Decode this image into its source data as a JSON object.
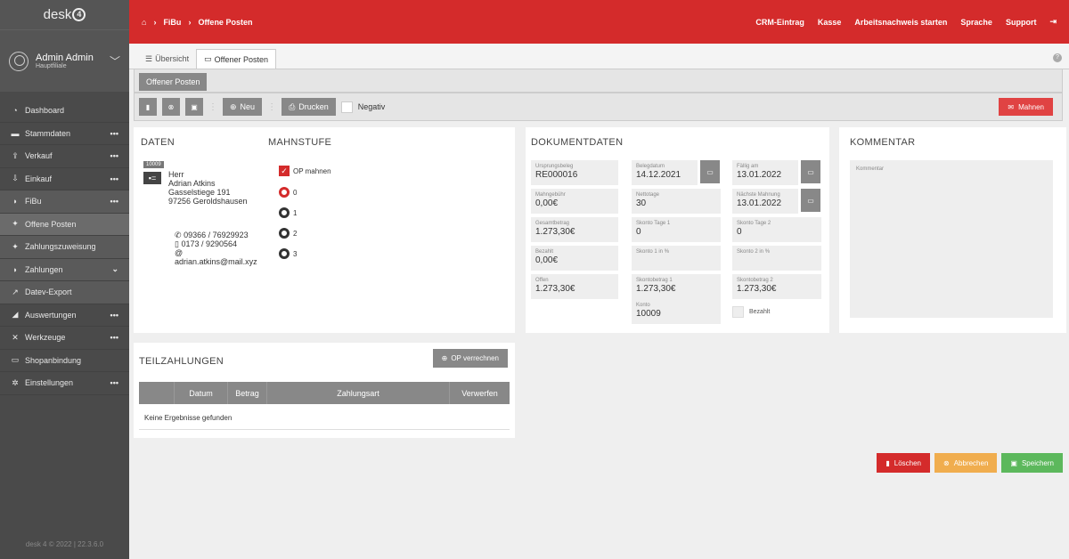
{
  "app": {
    "logo": "desk",
    "logo_mark": "4"
  },
  "user": {
    "name": "Admin Admin",
    "branch": "Hauptfiliale"
  },
  "sidebar": {
    "items": [
      {
        "label": "Dashboard",
        "icon": "dashboard-icon",
        "more": ""
      },
      {
        "label": "Stammdaten",
        "icon": "database-icon",
        "more": "•••"
      },
      {
        "label": "Verkauf",
        "icon": "upload-icon",
        "more": "•••"
      },
      {
        "label": "Einkauf",
        "icon": "download-icon",
        "more": "•••"
      },
      {
        "label": "FiBu",
        "icon": "fibu-icon",
        "more": "•••"
      },
      {
        "label": "Offene Posten",
        "icon": "money-icon",
        "more": ""
      },
      {
        "label": "Zahlungszuweisung",
        "icon": "money-icon",
        "more": ""
      },
      {
        "label": "Zahlungen",
        "icon": "payments-icon",
        "more": "⌄"
      },
      {
        "label": "Datev-Export",
        "icon": "export-icon",
        "more": ""
      },
      {
        "label": "Auswertungen",
        "icon": "chart-icon",
        "more": "•••"
      },
      {
        "label": "Werkzeuge",
        "icon": "tools-icon",
        "more": "•••"
      },
      {
        "label": "Shopanbindung",
        "icon": "shop-icon",
        "more": ""
      },
      {
        "label": "Einstellungen",
        "icon": "gear-icon",
        "more": "•••"
      }
    ],
    "footer": "desk 4 © 2022 | 22.3.6.0"
  },
  "topbar": {
    "crumb1": "FiBu",
    "crumb2": "Offene Posten",
    "crm": "CRM-Eintrag",
    "kasse": "Kasse",
    "arbeit": "Arbeitsnachweis starten",
    "sprache": "Sprache",
    "support": "Support"
  },
  "tabs": {
    "overview": "Übersicht",
    "current": "Offener Posten"
  },
  "subtoolbar": {
    "label": "Offener Posten"
  },
  "toolbar": {
    "neu": "Neu",
    "drucken": "Drucken",
    "negativ": "Negativ",
    "mahnen": "Mahnen"
  },
  "daten": {
    "title": "DATEN",
    "number": "10009",
    "salutation": "Herr",
    "name": "Adrian Atkins",
    "street": "Gasselstiege 191",
    "city": "97256 Geroldshausen",
    "phone": "09366 / 76929923",
    "mobile": "0173 / 9290564",
    "at": "@",
    "email": "adrian.atkins@mail.xyz"
  },
  "mahnstufe": {
    "title": "MAHNSTUFE",
    "op_mahnen": "OP mahnen",
    "levels": [
      "0",
      "1",
      "2",
      "3"
    ]
  },
  "dokument": {
    "title": "DOKUMENTDATEN",
    "ursprungsbeleg_l": "Ursprungsbeleg",
    "ursprungsbeleg": "RE000016",
    "belegdatum_l": "Belegdatum",
    "belegdatum": "14.12.2021",
    "faellig_l": "Fällig am",
    "faellig": "13.01.2022",
    "mahngebuehr_l": "Mahngebühr",
    "mahngebuehr": "0,00€",
    "nettotage_l": "Nettotage",
    "nettotage": "30",
    "naechste_l": "Nächste Mahnung",
    "naechste": "13.01.2022",
    "gesamt_l": "Gesamtbetrag",
    "gesamt": "1.273,30€",
    "skt1_l": "Skonto Tage 1",
    "skt1": "0",
    "skt2_l": "Skonto Tage 2",
    "skt2": "0",
    "bezahlt_l": "Bezahlt",
    "bezahlt": "0,00€",
    "sk1p_l": "Skonto 1 in %",
    "sk2p_l": "Skonto 2 in %",
    "offen_l": "Offen",
    "offen": "1.273,30€",
    "skb1_l": "Skontobetrag 1",
    "skb1": "1.273,30€",
    "skb2_l": "Skontobetrag 2",
    "skb2": "1.273,30€",
    "konto_l": "Konto",
    "konto": "10009",
    "bezahlt_chk": "Bezahlt"
  },
  "kommentar": {
    "title": "KOMMENTAR",
    "placeholder": "Kommentar"
  },
  "teilzahlungen": {
    "title": "TEILZAHLUNGEN",
    "op_btn": "OP verrechnen",
    "columns": [
      "",
      "Datum",
      "Betrag",
      "Zahlungsart",
      "Verwerfen"
    ],
    "empty": "Keine Ergebnisse gefunden"
  },
  "footer_buttons": {
    "loeschen": "Löschen",
    "abbrechen": "Abbrechen",
    "speichern": "Speichern"
  }
}
